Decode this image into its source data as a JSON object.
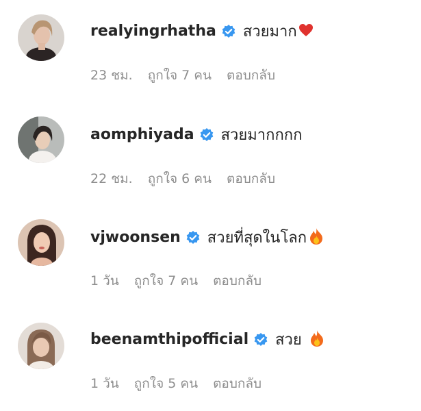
{
  "comments": [
    {
      "username": "realyingrhatha",
      "verified": true,
      "text": "สวยมาก",
      "emoji": "heart-emoji",
      "time": "23 ชม.",
      "likes": "ถูกใจ 7 คน",
      "reply": "ตอบกลับ"
    },
    {
      "username": "aomphiyada",
      "verified": true,
      "text": "สวยมากกกก",
      "emoji": "",
      "time": "22 ชม.",
      "likes": "ถูกใจ 6 คน",
      "reply": "ตอบกลับ"
    },
    {
      "username": "vjwoonsen",
      "verified": true,
      "text": "สวยที่สุดในโลก",
      "emoji": "fire-emoji",
      "time": "1 วัน",
      "likes": "ถูกใจ 7 คน",
      "reply": "ตอบกลับ"
    },
    {
      "username": "beenamthipofficial",
      "verified": true,
      "text": "สวย ",
      "emoji": "fire-emoji",
      "time": "1 วัน",
      "likes": "ถูกใจ 5 คน",
      "reply": "ตอบกลับ"
    }
  ],
  "colors": {
    "text": "#262626",
    "secondary": "#8e8e8e",
    "verified": "#3897f0"
  }
}
